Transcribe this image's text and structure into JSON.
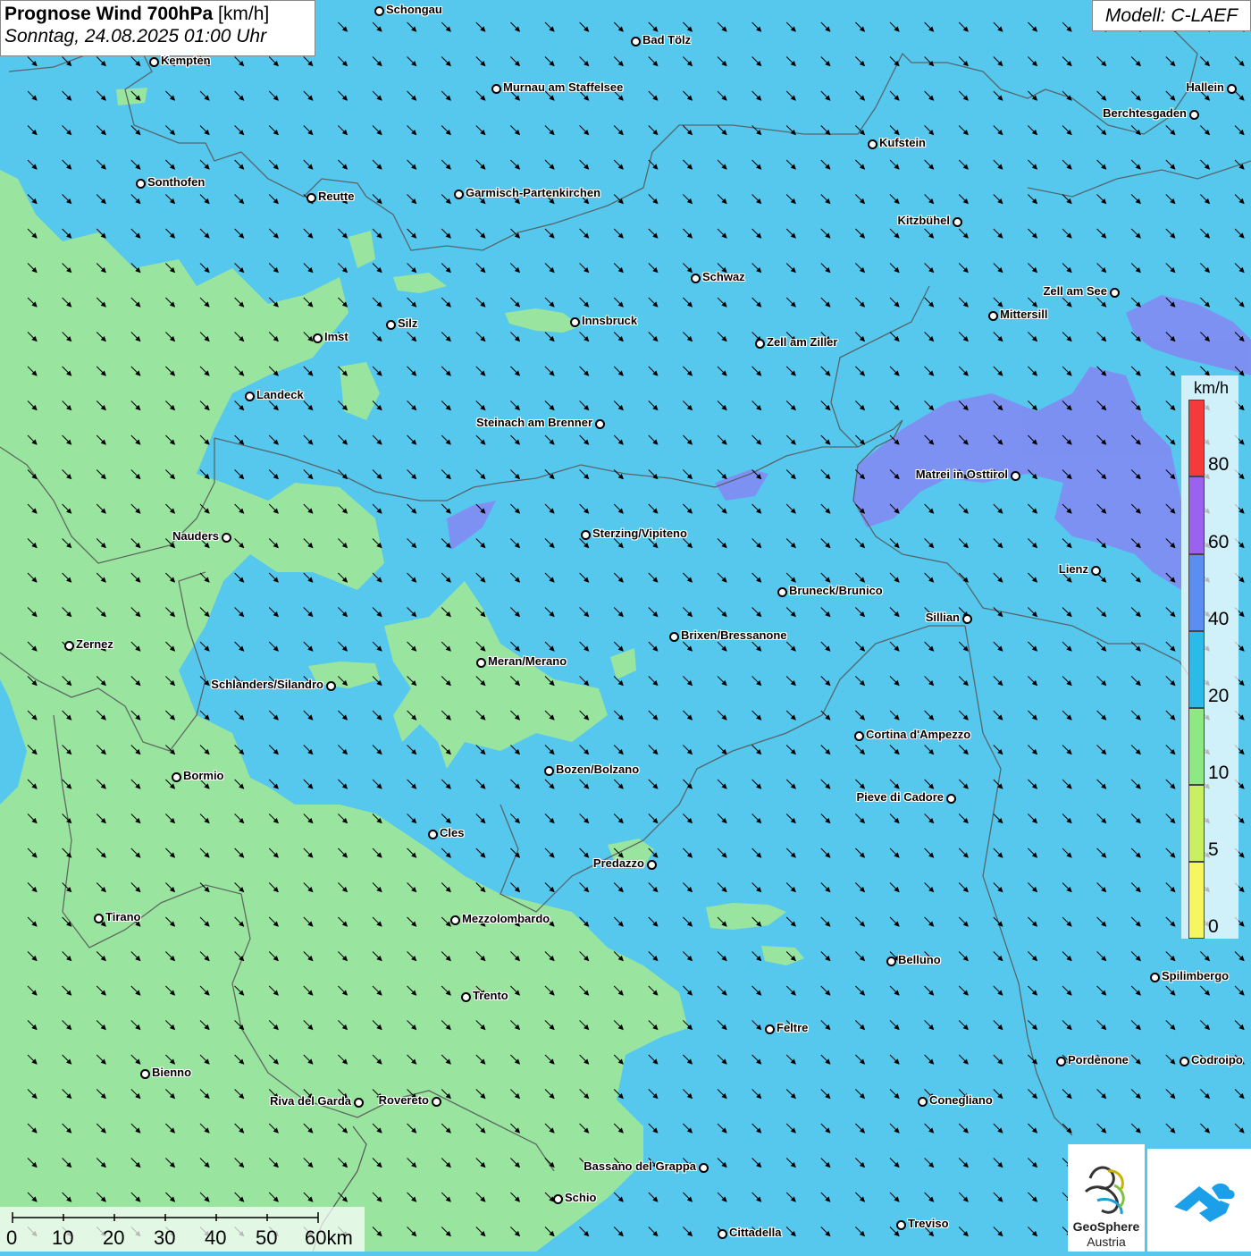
{
  "header": {
    "title_bold": "Prognose Wind 700hPa",
    "title_unit": " [km/h]",
    "subtitle": "Sonntag, 24.08.2025 01:00 Uhr",
    "model": "Modell: C-LAEF"
  },
  "legend": {
    "unit": "km/h",
    "labels": [
      "80",
      "60",
      "40",
      "20",
      "10",
      "5",
      "0"
    ],
    "colors": {
      "80_plus": "#f43a3a",
      "60_80": "#9a62ee",
      "40_60": "#5b8ef0",
      "20_40": "#2bbbe8",
      "10_20": "#8ee884",
      "5_10": "#c9f060",
      "0_5": "#f6f660"
    }
  },
  "scale_bar": {
    "labels": [
      "0",
      "10",
      "20",
      "30",
      "40",
      "50",
      "60km"
    ]
  },
  "wind": {
    "direction": "north-west to south-east",
    "background_color": "#56c8ee",
    "calm_zone_color": "#9de69a",
    "strong_zone_color": "#7f8ef2"
  },
  "cities": [
    {
      "name": "Schongau"
    },
    {
      "name": "Bad Tölz"
    },
    {
      "name": "Kempten"
    },
    {
      "name": "Murnau am Staffelsee"
    },
    {
      "name": "Hallein"
    },
    {
      "name": "Berchtesgaden"
    },
    {
      "name": "Kufstein"
    },
    {
      "name": "Sonthofen"
    },
    {
      "name": "Reutte"
    },
    {
      "name": "Garmisch-Partenkirchen"
    },
    {
      "name": "Kitzbühel"
    },
    {
      "name": "Schwaz"
    },
    {
      "name": "Zell am See"
    },
    {
      "name": "Innsbruck"
    },
    {
      "name": "Silz"
    },
    {
      "name": "Imst"
    },
    {
      "name": "Mittersill"
    },
    {
      "name": "Zell am Ziller"
    },
    {
      "name": "Landeck"
    },
    {
      "name": "Steinach am Brenner"
    },
    {
      "name": "Matrei in Osttirol"
    },
    {
      "name": "Nauders"
    },
    {
      "name": "Sterzing/Vipiteno"
    },
    {
      "name": "Lienz"
    },
    {
      "name": "Bruneck/Brunico"
    },
    {
      "name": "Sillian"
    },
    {
      "name": "Brixen/Bressanone"
    },
    {
      "name": "Zernez"
    },
    {
      "name": "Meran/Merano"
    },
    {
      "name": "Schlanders/Silandro"
    },
    {
      "name": "Cortina d'Ampezzo"
    },
    {
      "name": "Bozen/Bolzano"
    },
    {
      "name": "Bormio"
    },
    {
      "name": "Pieve di Cadore"
    },
    {
      "name": "Cles"
    },
    {
      "name": "Predazzo"
    },
    {
      "name": "Tirano"
    },
    {
      "name": "Mezzolombardo"
    },
    {
      "name": "Belluno"
    },
    {
      "name": "Spilimbergo"
    },
    {
      "name": "Trento"
    },
    {
      "name": "Feltre"
    },
    {
      "name": "Pordenone"
    },
    {
      "name": "Codroipo"
    },
    {
      "name": "Bienno"
    },
    {
      "name": "Riva del Garda"
    },
    {
      "name": "Rovereto"
    },
    {
      "name": "Conegliano"
    },
    {
      "name": "Bassano del Grappa"
    },
    {
      "name": "Schio"
    },
    {
      "name": "Treviso"
    },
    {
      "name": "Cittadella"
    }
  ],
  "logos": {
    "geosphere_line1": "GeoSphere",
    "geosphere_line2": "Austria"
  }
}
